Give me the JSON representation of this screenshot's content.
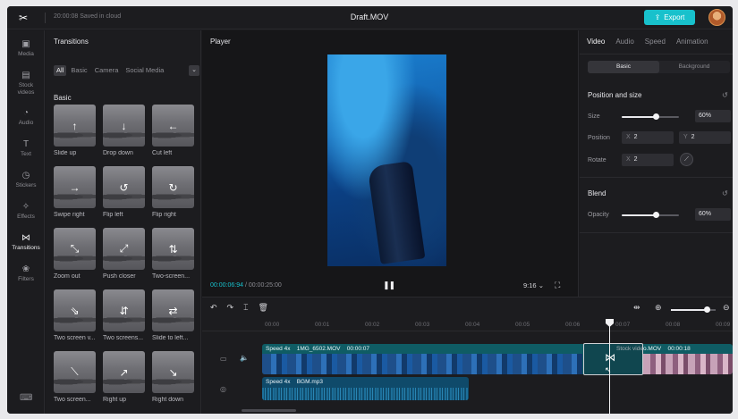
{
  "topbar": {
    "saved_text": "20:00:08 Saved in cloud",
    "title": "Draft.MOV",
    "export_label": "Export",
    "export_icon": "upload-icon",
    "accent": "#18c1cc"
  },
  "rail": {
    "items": [
      {
        "label": "Media",
        "icon": "media-icon"
      },
      {
        "label": "Stock\nvideos",
        "icon": "stock-videos-icon"
      },
      {
        "label": "Audio",
        "icon": "audio-icon"
      },
      {
        "label": "Text",
        "icon": "text-icon"
      },
      {
        "label": "Stickers",
        "icon": "stickers-icon"
      },
      {
        "label": "Effects",
        "icon": "effects-icon"
      },
      {
        "label": "Transitions",
        "icon": "transitions-icon"
      },
      {
        "label": "Filters",
        "icon": "filters-icon"
      }
    ],
    "active": "Transitions"
  },
  "transitions": {
    "title": "Transitions",
    "filters": [
      "All",
      "Basic",
      "Camera",
      "Social Media"
    ],
    "active_filter": "All",
    "section": "Basic",
    "tiles": [
      {
        "label": "Slide up",
        "glyph": "↑"
      },
      {
        "label": "Drop down",
        "glyph": "↓"
      },
      {
        "label": "Cut left",
        "glyph": "←"
      },
      {
        "label": "Swipe right",
        "glyph": "→"
      },
      {
        "label": "Flip left",
        "glyph": "↺"
      },
      {
        "label": "Flip right",
        "glyph": "↻"
      },
      {
        "label": "Zoom out",
        "glyph": "⤡"
      },
      {
        "label": "Push closer",
        "glyph": "⤢"
      },
      {
        "label": "Two-screen...",
        "glyph": "⇅"
      },
      {
        "label": "Two screen v...",
        "glyph": "⇘"
      },
      {
        "label": "Two screens...",
        "glyph": "⇵"
      },
      {
        "label": "Slide to left...",
        "glyph": "⇄"
      },
      {
        "label": "Two screen...",
        "glyph": "⟍"
      },
      {
        "label": "Right up",
        "glyph": "↗"
      },
      {
        "label": "Right down",
        "glyph": "↘"
      }
    ]
  },
  "player": {
    "title": "Player",
    "current_time": "00:00:06:94",
    "total_time": "00:00:25:00",
    "ratio": "9:16",
    "pause_icon": "pause-icon",
    "fullscreen_icon": "fullscreen-icon"
  },
  "properties": {
    "tabs": [
      "Video",
      "Audio",
      "Speed",
      "Animation"
    ],
    "active_tab": "Video",
    "segments": [
      "Basic",
      "Background"
    ],
    "active_segment": "Basic",
    "position_size": {
      "heading": "Position and size",
      "size_label": "Size",
      "size_value": "60%",
      "size_fraction": 0.6,
      "position_label": "Position",
      "x_label": "X",
      "x_value": "2",
      "y_label": "Y",
      "y_value": "2",
      "rotate_label": "Rotate",
      "rotate_x_label": "X",
      "rotate_value": "2"
    },
    "blend": {
      "heading": "Blend",
      "opacity_label": "Opacity",
      "opacity_value": "60%",
      "opacity_fraction": 0.6
    }
  },
  "timeline": {
    "ruler": [
      "00:00",
      "00:01",
      "00:02",
      "00:03",
      "00:04",
      "00:05",
      "00:06",
      "00:07",
      "00:08",
      "00:09"
    ],
    "video_clip": {
      "speed": "Speed 4x",
      "name": "1MG_6502.MOV",
      "duration": "00:00:07"
    },
    "stock_clip": {
      "name": "Stock video.MOV",
      "duration": "00:00:18"
    },
    "audio_clip": {
      "speed": "Speed 4x",
      "name": "BGM.mp3"
    },
    "zoom_fraction": 0.8
  }
}
